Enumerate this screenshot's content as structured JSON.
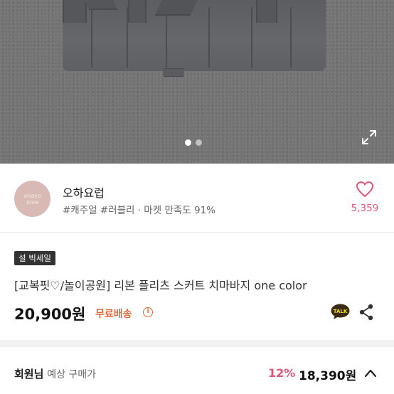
{
  "gallery": {
    "slide_count": 2,
    "active_slide": 1,
    "expand_icon": "expand-icon"
  },
  "shop": {
    "logo_text": "ohayo\nlove",
    "name": "오하요럽",
    "tags": "#캐주얼 #러블리 · 마켓 만족도 91%",
    "likes": "5,359",
    "heart_icon": "heart-outline-icon",
    "accent_color": "#e25577"
  },
  "product": {
    "badge": "설 빅세일",
    "title": "[교복핏♡/놀이공원] 리본 플리츠 스커트 치마바지 one color",
    "price": "20,900원",
    "shipping": "무료배송",
    "shipping_info_icon": "ⓘ",
    "talk_label": "TALK",
    "shipping_color": "#e26b3a"
  },
  "member_price": {
    "label_bold": "회원님",
    "label_rest": "예상 구매가",
    "discount": "12%",
    "price": "18,390원"
  }
}
